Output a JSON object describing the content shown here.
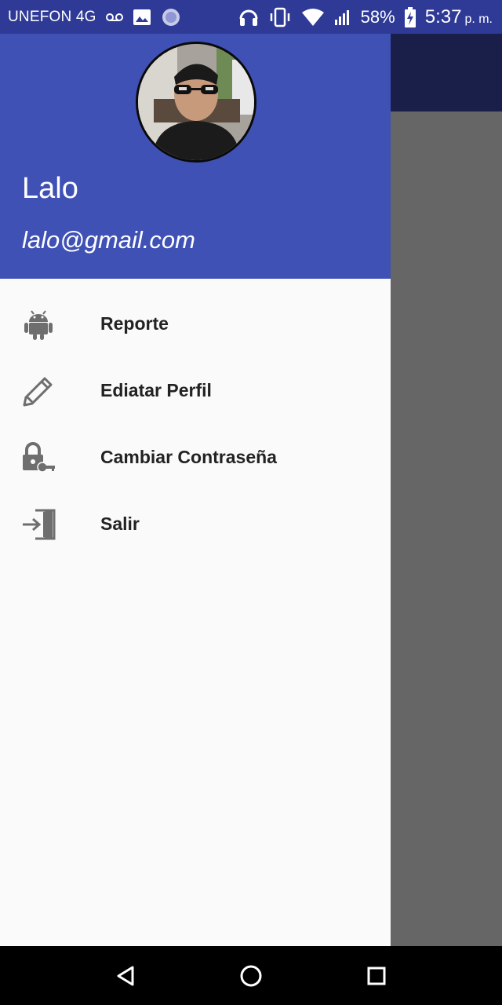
{
  "status_bar": {
    "carrier": "UNEFON 4G",
    "battery": "58%",
    "time": "5:37",
    "ampm": "p. m.",
    "icons": [
      "voicemail-icon",
      "image-icon",
      "sync-icon",
      "headphones-icon",
      "vibrate-icon",
      "wifi-icon",
      "signal-icon",
      "battery-charging-icon"
    ]
  },
  "drawer": {
    "header": {
      "name": "Lalo",
      "email": "lalo@gmail.com",
      "avatar": "profile-photo"
    },
    "items": [
      {
        "label": "Reporte",
        "icon": "android-icon"
      },
      {
        "label": "Ediatar Perfil",
        "icon": "pencil-icon"
      },
      {
        "label": "Cambiar Contraseña",
        "icon": "lock-key-icon"
      },
      {
        "label": "Salir",
        "icon": "exit-icon"
      }
    ]
  },
  "colors": {
    "status_bar": "#2f3a96",
    "drawer_header": "#3f51b5",
    "scrim": "#666666",
    "toolbar_dark": "#1a1f4a"
  },
  "nav_bar": {
    "buttons": [
      "back-icon",
      "home-icon",
      "recents-icon"
    ]
  }
}
